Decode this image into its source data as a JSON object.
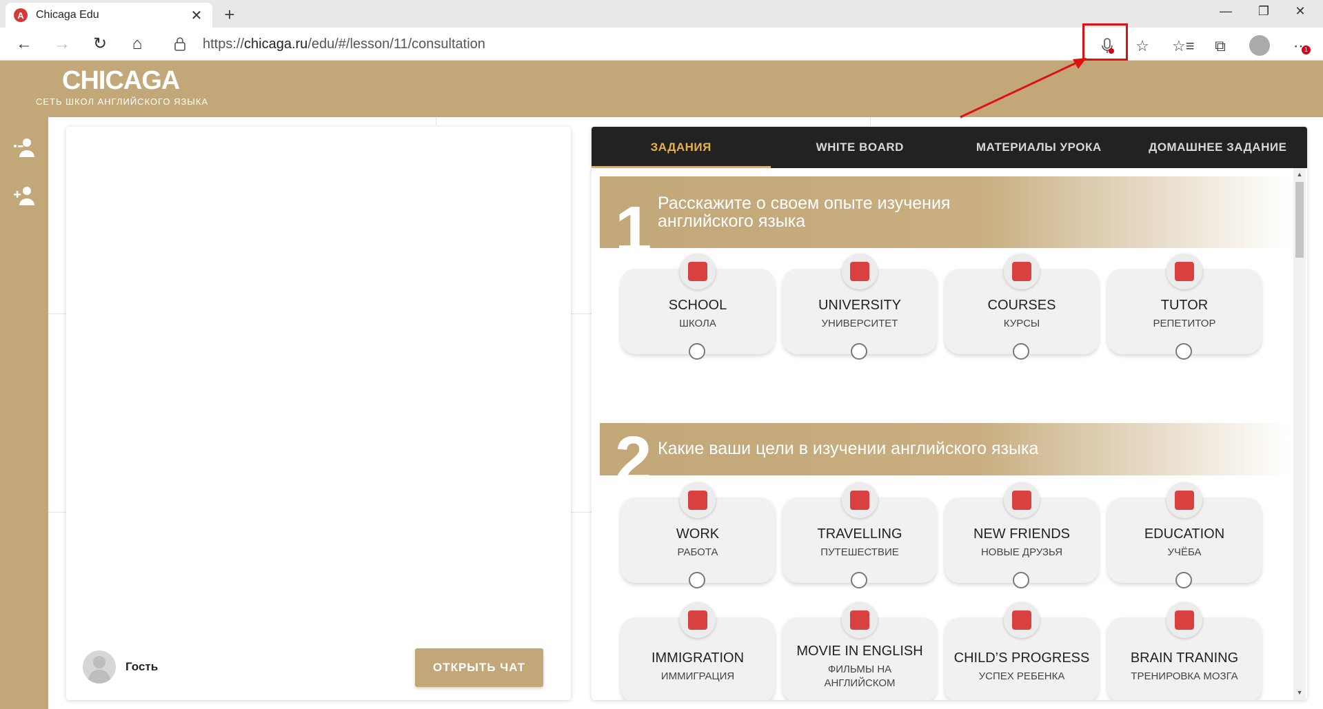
{
  "browser": {
    "tab_title": "Chicaga Edu",
    "favicon_letter": "A",
    "url_prefix": "https://",
    "url_host": "chicaga.ru",
    "url_path": "/edu/#/lesson/11/consultation",
    "more_badge": "1"
  },
  "site": {
    "logo": "CHICAGA",
    "logo_sub": "СЕТЬ ШКОЛ АНГЛИЙСКОГО ЯЗЫКА"
  },
  "chat": {
    "guest_name": "Гость",
    "open_chat_label": "ОТКРЫТЬ ЧАТ"
  },
  "lesson": {
    "tabs": [
      "ЗАДАНИЯ",
      "WHITE BOARD",
      "МАТЕРИАЛЫ УРОКА",
      "ДОМАШНЕЕ ЗАДАНИЕ"
    ],
    "active_tab": "ЗАДАНИЯ",
    "sections": [
      {
        "number": "1",
        "title": "Расскажите о своем опыте изучения английского языка",
        "options": [
          {
            "en": "SCHOOL",
            "ru": "ШКОЛА",
            "icon": "school-icon"
          },
          {
            "en": "UNIVERSITY",
            "ru": "УНИВЕРСИТЕТ",
            "icon": "university-icon"
          },
          {
            "en": "COURSES",
            "ru": "КУРСЫ",
            "icon": "courses-icon"
          },
          {
            "en": "TUTOR",
            "ru": "РЕПЕТИТОР",
            "icon": "tutor-icon"
          }
        ]
      },
      {
        "number": "2",
        "title": "Какие ваши цели в изучении английского языка",
        "options": [
          {
            "en": "WORK",
            "ru": "РАБОТА",
            "icon": "briefcase-icon"
          },
          {
            "en": "TRAVELLING",
            "ru": "ПУТЕШЕСТВИЕ",
            "icon": "travel-icon"
          },
          {
            "en": "NEW FRIENDS",
            "ru": "НОВЫЕ ДРУЗЬЯ",
            "icon": "friends-icon"
          },
          {
            "en": "EDUCATION",
            "ru": "УЧЁБА",
            "icon": "graduate-icon"
          },
          {
            "en": "IMMIGRATION",
            "ru": "ИММИГРАЦИЯ",
            "icon": "immigration-icon"
          },
          {
            "en": "MOVIE IN ENGLISH",
            "ru": "ФИЛЬМЫ НА АНГЛИЙСКОМ",
            "icon": "movie-icon"
          },
          {
            "en": "CHILD’S PROGRESS",
            "ru": "УСПЕХ РЕБЕНКА",
            "icon": "child-icon"
          },
          {
            "en": "BRAIN TRANING",
            "ru": "ТРЕНИРОВКА МОЗГА",
            "icon": "brain-icon"
          }
        ]
      }
    ]
  },
  "colors": {
    "brand_gold": "#c2a878",
    "active_tab": "#e8b24a",
    "icon_red": "#d94040",
    "highlight_red": "#e01010"
  }
}
